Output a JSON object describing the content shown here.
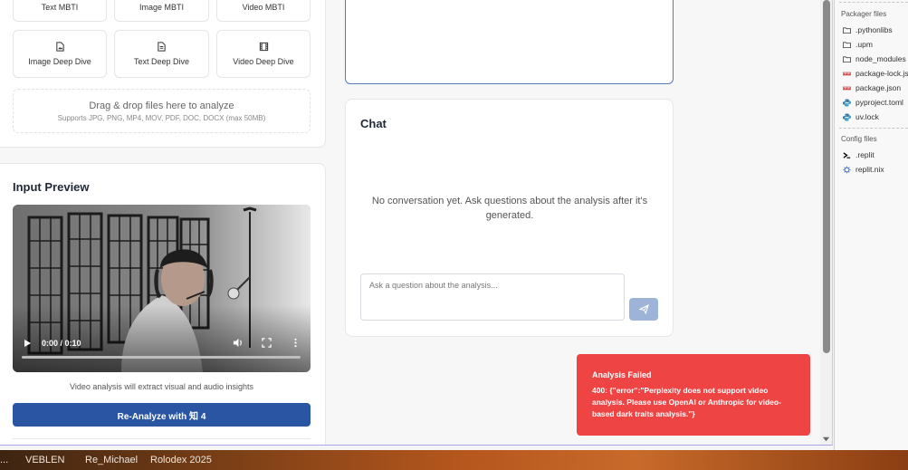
{
  "modes_row1": [
    {
      "label": "Text MBTI"
    },
    {
      "label": "Image MBTI"
    },
    {
      "label": "Video MBTI"
    }
  ],
  "modes_row2": [
    {
      "label": "Image Deep Dive",
      "icon": "image-file-icon"
    },
    {
      "label": "Text Deep Dive",
      "icon": "text-file-icon"
    },
    {
      "label": "Video Deep Dive",
      "icon": "film-icon"
    }
  ],
  "dropzone": {
    "title": "Drag & drop files here to analyze",
    "subtitle": "Supports JPG, PNG, MP4, MOV, PDF, DOC, DOCX (max 50MB)"
  },
  "preview": {
    "title": "Input Preview",
    "time": "0:00 / 0:10",
    "hint": "Video analysis will extract visual and audio insights",
    "reanalyze_label": "Re-Analyze with 知 4"
  },
  "chat": {
    "title": "Chat",
    "empty_text": "No conversation yet. Ask questions about the analysis after it's generated.",
    "input_placeholder": "Ask a question about the analysis..."
  },
  "toast": {
    "title": "Analysis Failed",
    "message": "400: {\"error\":\"Perplexity does not support video analysis. Please use OpenAI or Anthropic for video-based dark traits analysis.\"}",
    "color": "#ef4444"
  },
  "files": {
    "packager_title": "Packager files",
    "packager_items": [
      {
        "name": ".pythonlibs",
        "icon": "folder-icon"
      },
      {
        "name": ".upm",
        "icon": "folder-icon"
      },
      {
        "name": "node_modules",
        "icon": "folder-icon"
      },
      {
        "name": "package-lock.json",
        "icon": "npm-icon"
      },
      {
        "name": "package.json",
        "icon": "npm-icon"
      },
      {
        "name": "pyproject.toml",
        "icon": "python-icon"
      },
      {
        "name": "uv.lock",
        "icon": "python-icon"
      }
    ],
    "config_title": "Config files",
    "config_items": [
      {
        "name": ".replit",
        "icon": "terminal-icon"
      },
      {
        "name": "replit.nix",
        "icon": "gear-icon"
      }
    ]
  },
  "taskbar": {
    "items": [
      "...",
      "VEBLEN",
      "Re_Michael",
      "Rolodex 2025"
    ]
  },
  "colors": {
    "primary": "#2a55a3",
    "error": "#ef4444",
    "send": "#9db3d8"
  }
}
